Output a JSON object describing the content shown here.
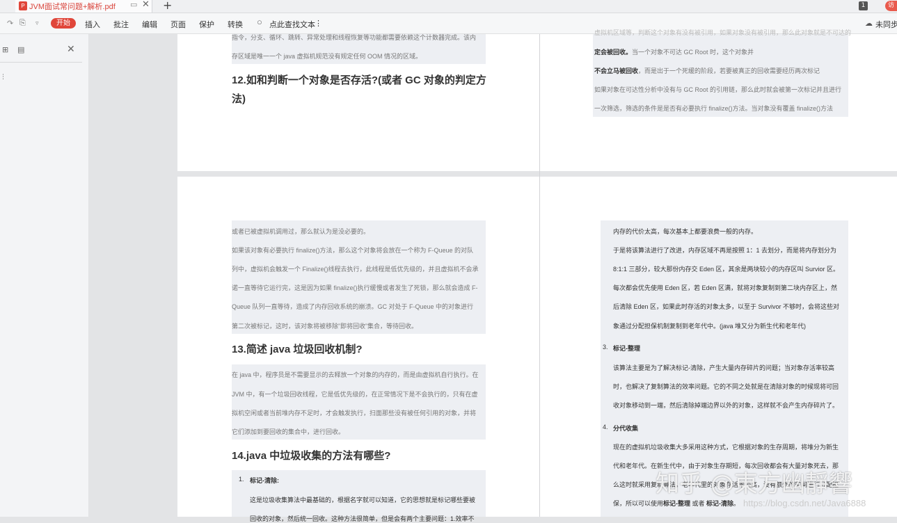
{
  "tabbar": {
    "tab_title": "JVM面试常问题+解析.pdf",
    "pin_icon": "monitor-icon",
    "close": "✕",
    "new_tab": "+",
    "page_badge": "1",
    "visitor_label": "访"
  },
  "toolbar": {
    "start": "开始",
    "insert": "插入",
    "annotate": "批注",
    "edit": "编辑",
    "page": "页面",
    "protect": "保护",
    "convert": "转换",
    "search": "点此查找文本",
    "more": "⋮",
    "sync": "未同步"
  },
  "colors": {
    "accent": "#e0463a",
    "highlight": "#edeff3"
  },
  "page1_left": {
    "lines": [
      "指令，分支、循环、跳转、异常处理和线程恢复等功能都需要依赖这个计数器完成。该内",
      "存区域是唯一一个 java 虚拟机规范没有规定任何 OOM 情况的区域。"
    ],
    "heading_line1": "12.如和判断一个对象是否存活?(或者 GC 对象的判定方",
    "heading_line2": "法)"
  },
  "page1_right": {
    "line0": "虚拟机区域等，判断这个对象有没有被引用，如果对象没有被引用，那么此对象就是不可达的",
    "line1_bold": "定会被回收。",
    "line1_rest": "当一个对象不可达 GC Root 时，这个对象并",
    "line2_bold": "不会立马被回收",
    "line2_rest": "，而是出于一个死缓的阶段，若要被真正的回收需要经历两次标记",
    "line3": "如果对象在可达性分析中没有与 GC Root 的引用链，那么此时就会被第一次标记并且进行",
    "line4": "一次筛选，筛选的条件是是否有必要执行 finalize()方法。当对象没有覆盖 finalize()方法"
  },
  "page2_left": {
    "lines_a": [
      "或者已被虚拟机调用过，那么就认为是没必要的。",
      "如果该对象有必要执行 finalize()方法，那么这个对象将会放在一个称为 F-Queue 的对队",
      "列中，虚拟机会触发一个 Finalize()线程去执行，此线程是低优先级的，并且虚拟机不会承",
      "诺一直等待它运行完，这是因为如果 finalize()执行缓慢或者发生了死锁，那么就会造成 F-",
      "Queue 队列一直等待，造成了内存回收系统的崩溃。GC 对处于 F-Queue 中的对象进行",
      "第二次被标记，这时，该对象将被移除”即将回收”集合，等待回收。"
    ],
    "heading13": "13.简述 java 垃圾回收机制?",
    "lines_b": [
      "在 java 中，程序员是不需要显示的去释放一个对象的内存的，而是由虚拟机自行执行。在",
      "JVM 中，有一个垃圾回收线程，它是低优先级的，在正常情况下是不会执行的，只有在虚",
      "拟机空闲或者当前堆内存不足时，才会触发执行，扫面那些没有被任何引用的对象，并将",
      "它们添加到要回收的集合中，进行回收。"
    ],
    "heading14": "14.java 中垃圾收集的方法有哪些?",
    "item1_num": "1.",
    "item1_title": "标记-清除:",
    "item1_line1": "这是垃圾收集算法中最基础的，根据名字就可以知道，它的思想就是标记哪些要被",
    "item1_line2": "回收的对象，然后统一回收。这种方法很简单，但是会有两个主要问题：1.效率不"
  },
  "page2_right": {
    "lines_a": [
      "内存的代价太高，每次基本上都要浪费一般的内存。",
      "于是将该算法进行了改进，内存区域不再是按照 1：1 去划分，而是将内存划分为",
      "8:1:1 三部分，较大那份内存交 Eden 区，其余是两块较小的内存区叫 Survior 区。",
      "每次都会优先使用 Eden 区，若 Eden 区满，就将对象复制到第二块内存区上，然",
      "后清除 Eden 区，如果此时存活的对象太多，以至于 Survivor 不够时，会将这些对",
      "象通过分配担保机制复制到老年代中。(java 堆又分为新生代和老年代)"
    ],
    "item3_num": "3.",
    "item3_title": "标记-整理",
    "lines_b": [
      "该算法主要是为了解决标记-清除，产生大量内存碎片的问题；当对象存活率较高",
      "时，也解决了复制算法的效率问题。它的不同之处就是在清除对象的时候现将可回",
      "收对象移动到一端，然后清除掉端边界以外的对象，这样就不会产生内存碎片了。"
    ],
    "item4_num": "4.",
    "item4_title": "分代收集",
    "lines_c": [
      "现在的虚拟机垃圾收集大多采用这种方式，它根据对象的生存周期，将堆分为新生",
      "代和老年代。在新生代中，由于对象生存期短，每次回收都会有大量对象死去，那",
      "么这时就采用复制算法。老年代里的对象存活率较高，没有额外的空间进行分配担"
    ],
    "last_prefix": "保，所以可以使用",
    "last_b1": "标记-整理",
    "last_mid": " 或者 ",
    "last_b2": "标记-清除",
    "last_end": "。"
  },
  "watermark": {
    "zhihu": "知乎 @東方幽靜響",
    "csdn": "https://blog.csdn.net/Java6888"
  }
}
